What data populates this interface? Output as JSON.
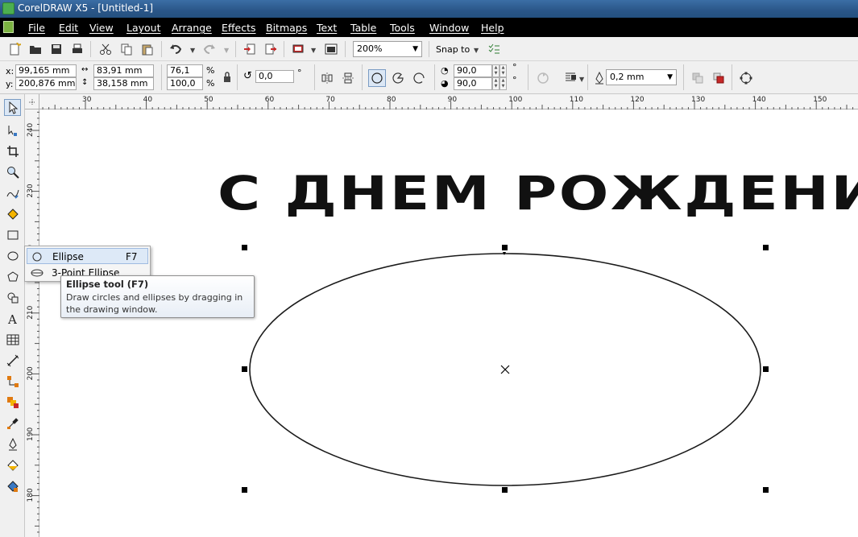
{
  "window": {
    "title": "CorelDRAW X5 - [Untitled-1]"
  },
  "menu": {
    "items": [
      {
        "label": "File"
      },
      {
        "label": "Edit"
      },
      {
        "label": "View"
      },
      {
        "label": "Layout"
      },
      {
        "label": "Arrange"
      },
      {
        "label": "Effects"
      },
      {
        "label": "Bitmaps"
      },
      {
        "label": "Text"
      },
      {
        "label": "Table"
      },
      {
        "label": "Tools"
      },
      {
        "label": "Window"
      },
      {
        "label": "Help"
      }
    ]
  },
  "standard_toolbar": {
    "zoom_level": "200%",
    "snap_to_label": "Snap to"
  },
  "property_bar": {
    "x_label": "x:",
    "x_value": "99,165 mm",
    "y_label": "y:",
    "y_value": "200,876 mm",
    "width_value": "83,91 mm",
    "height_value": "38,158 mm",
    "scale_x": "76,1",
    "scale_y": "100,0",
    "percent": "%",
    "rotation": "0,0",
    "degree": "°",
    "start_angle": "90,0",
    "end_angle": "90,0",
    "outline_width": "0,2 mm"
  },
  "rulers": {
    "horizontal_labels": [
      "30",
      "40",
      "50",
      "60",
      "70",
      "80",
      "90",
      "100",
      "110",
      "120",
      "130",
      "140",
      "150"
    ],
    "vertical_labels": [
      "240",
      "230",
      "220",
      "210",
      "200",
      "190",
      "180"
    ]
  },
  "canvas": {
    "artistic_text": "С ДНЕМ РОЖДЕНИЯ"
  },
  "flyout": {
    "items": [
      {
        "label": "Ellipse",
        "shortcut": "F7",
        "icon": "ellipse-icon"
      },
      {
        "label": "3-Point Ellipse",
        "shortcut": "",
        "icon": "three-point-ellipse-icon"
      }
    ]
  },
  "tooltip": {
    "title": "Ellipse tool (F7)",
    "body": "Draw circles and ellipses by dragging in the drawing window."
  },
  "colors": {
    "title_bar": "#2a5688",
    "menu_bar": "#000000",
    "toolbar": "#f0f0f0",
    "selection_highlight": "#dde9f7"
  }
}
